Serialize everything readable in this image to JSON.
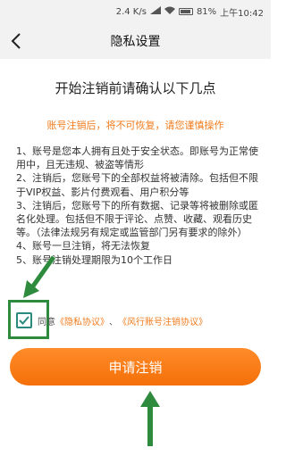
{
  "status_bar": {
    "speed": "2.4 K/s",
    "battery": "81%",
    "time": "上午10:42"
  },
  "header": {
    "title": "隐私设置",
    "back_icon": "chevron-left-icon"
  },
  "main": {
    "heading": "开始注销前请确认以下几点",
    "warning": "账号注销后，将不可恢复，请您谨慎操作",
    "terms": [
      "1、账号是您本人拥有且处于安全状态。即账号为正常使用中，且无违规、被盗等情形",
      "2、注销后，您账号下的全部权益将被清除。包括但不限于VIP权益、影片付费观看、用户积分等",
      "3、注销后，您账号下的所有数据、记录等将被删除或匿名化处理。包括但不限于评论、点赞、收藏、观看历史等。（法律法规另有规定或监管部门另有要求的除外）",
      "4、账号一旦注销，将无法恢复",
      "5、账号注销处理期限为10个工作日"
    ],
    "agree": {
      "checked": true,
      "prefix": "同意",
      "link1": "《隐私协议》",
      "separator": "、",
      "link2": "《风行账号注销协议》"
    },
    "submit_label": "申请注销"
  },
  "colors": {
    "accent": "#f46f08",
    "warning": "#f07c1e",
    "checkbox": "#2a8a7d",
    "annotation": "#2e8b3e"
  }
}
